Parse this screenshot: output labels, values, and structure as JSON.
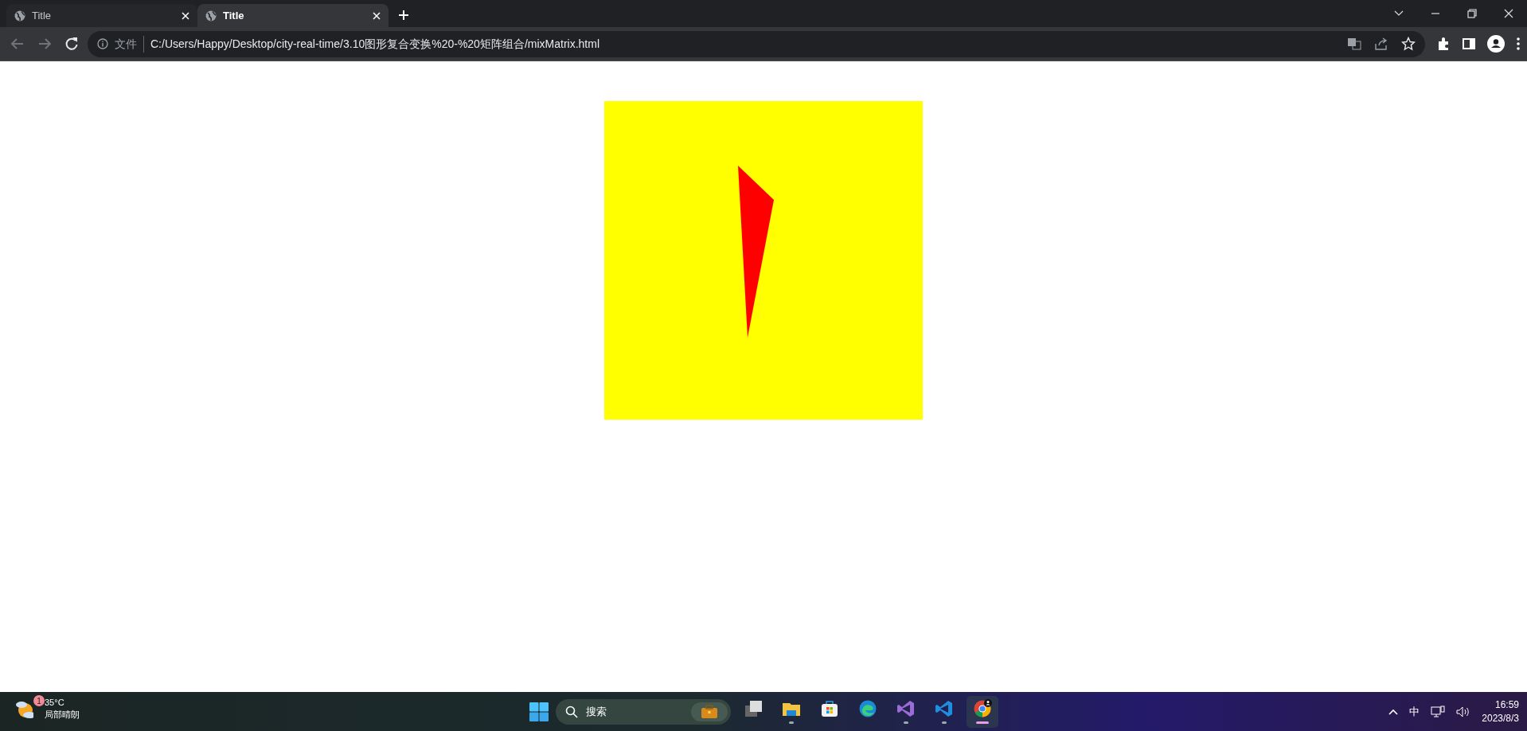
{
  "browser": {
    "tabs": [
      {
        "title": "Title",
        "selected": false
      },
      {
        "title": "Title",
        "selected": true
      }
    ],
    "address_bar": {
      "scheme_label": "文件",
      "url": "C:/Users/Happy/Desktop/city-real-time/3.10图形复合变换%20-%20矩阵组合/mixMatrix.html"
    }
  },
  "taskbar": {
    "weather": {
      "badge": "1",
      "temperature": "35°C",
      "condition": "局部晴朗"
    },
    "search": {
      "placeholder": "搜索"
    },
    "apps": [
      {
        "kind": "taskview",
        "running": false,
        "selected": false
      },
      {
        "kind": "folder",
        "running": true,
        "selected": false
      },
      {
        "kind": "store",
        "running": false,
        "selected": false
      },
      {
        "kind": "edge",
        "running": false,
        "selected": false
      },
      {
        "kind": "vs",
        "running": true,
        "selected": false
      },
      {
        "kind": "vscode",
        "running": true,
        "selected": false
      },
      {
        "kind": "chrome",
        "running": true,
        "selected": true
      }
    ],
    "tray": {
      "ime": "中",
      "time": "16:59",
      "date": "2023/8/3"
    }
  }
}
